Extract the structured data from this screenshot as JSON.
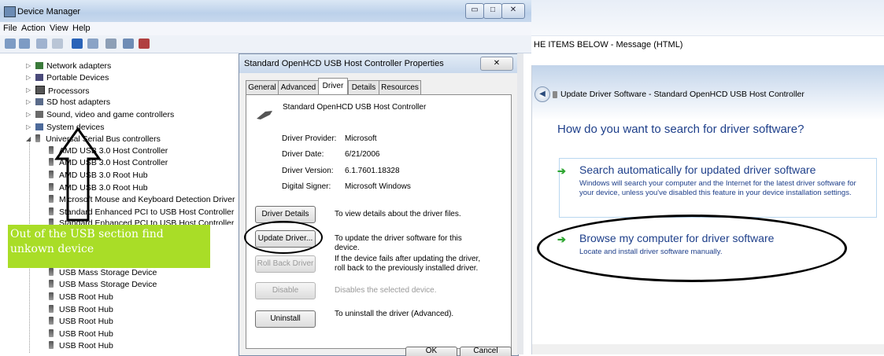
{
  "device_manager": {
    "title": "Device Manager",
    "menu": [
      "File",
      "Action",
      "View",
      "Help"
    ],
    "tree": [
      {
        "label": "Network adapters",
        "color": "#3a7a3a"
      },
      {
        "label": "Portable Devices",
        "color": "#4a4a7a"
      },
      {
        "label": "Processors",
        "color": "#555555"
      },
      {
        "label": "SD host adapters",
        "color": "#5a6b8a"
      },
      {
        "label": "Sound, video and game controllers",
        "color": "#6a6a6a"
      },
      {
        "label": "System devices",
        "color": "#4d6a9a"
      },
      {
        "label": "Universal Serial Bus controllers",
        "color": "#555555"
      }
    ],
    "usb_children": [
      "AMD USB 3.0 Host Controller",
      "AMD USB 3.0 Host Controller",
      "AMD USB 3.0 Root Hub",
      "AMD USB 3.0 Root Hub",
      "Microsoft Mouse and Keyboard Detection Driver",
      "Standard Enhanced PCI to USB Host Controller",
      "Standard Enhanced PCI to USB Host Controller"
    ],
    "usb_children_lower": [
      "USB Mass Storage Device",
      "USB Mass Storage Device",
      "USB Root Hub",
      "USB Root Hub",
      "USB Root Hub",
      "USB Root Hub",
      "USB Root Hub"
    ]
  },
  "callout": {
    "text": "Out of the USB section find unkown device",
    "color": "#a9dd27"
  },
  "properties": {
    "title": "Standard OpenHCD USB Host Controller Properties",
    "tabs": [
      "General",
      "Advanced",
      "Driver",
      "Details",
      "Resources"
    ],
    "active_tab": "Driver",
    "device_name": "Standard OpenHCD USB Host Controller",
    "fields": [
      {
        "label": "Driver Provider:",
        "value": "Microsoft"
      },
      {
        "label": "Driver Date:",
        "value": "6/21/2006"
      },
      {
        "label": "Driver Version:",
        "value": "6.1.7601.18328"
      },
      {
        "label": "Digital Signer:",
        "value": "Microsoft Windows"
      }
    ],
    "buttons": [
      {
        "label": "Driver Details",
        "desc": "To view details about the driver files.",
        "disabled": false
      },
      {
        "label": "Update Driver...",
        "desc": "To update the driver software for this device.",
        "disabled": false
      },
      {
        "label": "Roll Back Driver",
        "desc": "If the device fails after updating the driver, roll back to the previously installed driver.",
        "disabled": true
      },
      {
        "label": "Disable",
        "desc": "Disables the selected device.",
        "disabled": true
      },
      {
        "label": "Uninstall",
        "desc": "To uninstall the driver (Advanced).",
        "disabled": false
      }
    ],
    "ok": "OK",
    "cancel": "Cancel"
  },
  "message_window": {
    "title": "HE ITEMS BELOW - Message (HTML)"
  },
  "update_wizard": {
    "title": "Update Driver Software - Standard OpenHCD USB Host Controller",
    "question": "How do you want to search for driver software?",
    "option1_head": "Search automatically for updated driver software",
    "option1_body": "Windows will search your computer and the Internet for the latest driver software for your device, unless you've disabled this feature in your device installation settings.",
    "option2_head": "Browse my computer for driver software",
    "option2_body": "Locate and install driver software manually."
  }
}
